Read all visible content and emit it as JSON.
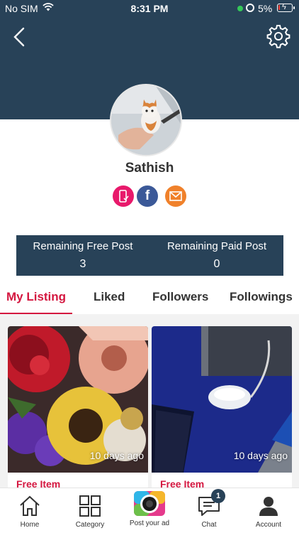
{
  "status_bar": {
    "carrier": "No SIM",
    "time": "8:31 PM",
    "battery_percent": "5%",
    "battery_level": 0.05
  },
  "header": {
    "back_icon": "chevron-left-icon",
    "settings_icon": "gear-icon",
    "background_color": "#284258"
  },
  "profile": {
    "name": "Sathish",
    "avatar_icon": "kitten-photo",
    "social": [
      {
        "icon": "phone-icon",
        "color": "#e8196b"
      },
      {
        "icon": "facebook-icon",
        "color": "#3b5998"
      },
      {
        "icon": "mail-icon",
        "color": "#f0812b"
      }
    ]
  },
  "stats": {
    "free_label": "Remaining Free Post",
    "free_value": "3",
    "paid_label": "Remaining Paid Post",
    "paid_value": "0"
  },
  "tabs": [
    {
      "label": "My Listing",
      "active": true
    },
    {
      "label": "Liked",
      "active": false
    },
    {
      "label": "Followers",
      "active": false
    },
    {
      "label": "Followings",
      "active": false
    }
  ],
  "listings": [
    {
      "time_ago": "10 days ago",
      "type": "Free Item"
    },
    {
      "time_ago": "10 days ago",
      "type": "Free Item"
    }
  ],
  "bottom_nav": [
    {
      "label": "Home",
      "icon": "home-icon"
    },
    {
      "label": "Category",
      "icon": "grid-icon"
    },
    {
      "label": "Post your ad",
      "icon": "camera-icon"
    },
    {
      "label": "Chat",
      "icon": "chat-icon",
      "badge": "1"
    },
    {
      "label": "Account",
      "icon": "user-icon"
    }
  ],
  "colors": {
    "accent": "#d4163f",
    "brand": "#284258"
  }
}
